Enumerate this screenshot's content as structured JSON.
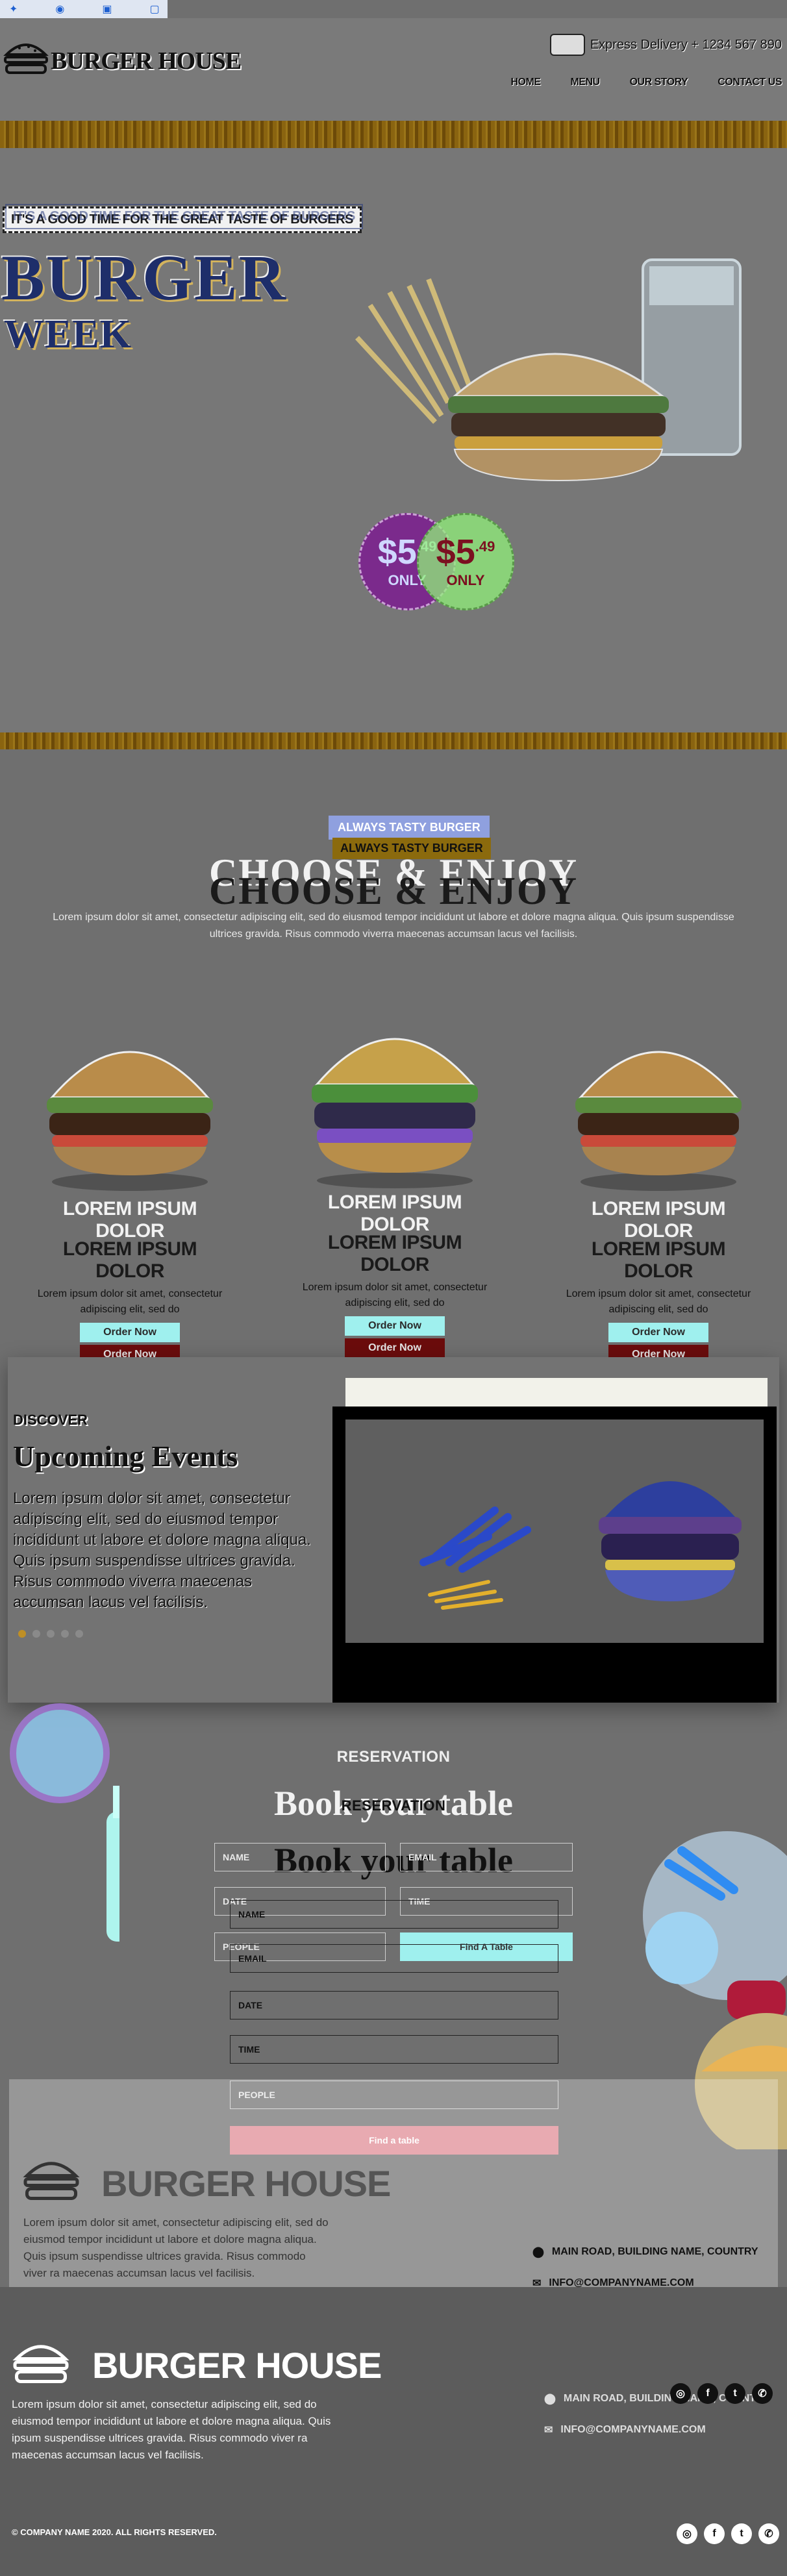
{
  "colors": {
    "gold_stripe": "#8a6410",
    "navy": "#1e2e6a",
    "purple_badge": "#7b2a8c",
    "green_badge": "#90f07a",
    "teal_button": "#9ff0ee",
    "pink_button": "#e08a94",
    "maroon": "#6b0c0c",
    "chip_blue": "#8fa0df"
  },
  "browser_icons": [
    "cursor-icon",
    "eye-icon",
    "lock-icon",
    "page-icon"
  ],
  "brand": {
    "name": "BURGER HOUSE"
  },
  "header": {
    "phone": "Express Delivery + 1234 567 890"
  },
  "nav": {
    "items": [
      "HOME",
      "MENU",
      "OUR STORY",
      "CONTACT US"
    ]
  },
  "hero": {
    "tagline": "IT'S A GOOD TIME FOR THE GREAT TASTE OF BURGERS",
    "headline": "BURGER",
    "subheadline": "WEEK",
    "price_main": "$5",
    "price_cents": ".49",
    "price_note": "ONLY"
  },
  "about": {
    "chip": "ALWAYS TASTY BURGER",
    "heading": "CHOOSE & ENJOY",
    "text": "Lorem ipsum dolor sit amet, consectetur adipiscing elit, sed do eiusmod tempor incididunt ut labore et dolore magna aliqua. Quis ipsum suspendisse ultrices gravida. Risus commodo viverra maecenas accumsan lacus vel facilisis."
  },
  "cards": [
    {
      "title": "LOREM IPSUM DOLOR",
      "text": "Lorem ipsum dolor sit amet, consectetur adipiscing elit, sed do",
      "button": "Order Now"
    },
    {
      "title": "LOREM IPSUM DOLOR",
      "text": "Lorem ipsum dolor sit amet, consectetur adipiscing elit, sed do",
      "button": "Order Now"
    },
    {
      "title": "LOREM IPSUM DOLOR",
      "text": "Lorem ipsum dolor sit amet, consectetur adipiscing elit, sed do",
      "button": "Order Now"
    }
  ],
  "events": {
    "eyebrow": "DISCOVER",
    "heading": "Upcoming Events",
    "text": "Lorem ipsum dolor sit amet, consectetur adipiscing elit, sed do eiusmod tempor incididunt ut labore et dolore magna aliqua. Quis ipsum suspendisse ultrices gravida. Risus commodo viverra maecenas accumsan lacus vel facilisis.",
    "active_slide": 1,
    "slide_count": 5
  },
  "reservation": {
    "label": "RESERVATION",
    "heading": "Book your table",
    "fields": {
      "name": "NAME",
      "email": "EMAIL",
      "date": "DATE",
      "time": "TIME",
      "people": "PEOPLE"
    },
    "button": "Find A Table",
    "button_alt": "Find a table"
  },
  "footer": {
    "brand": "BURGER HOUSE",
    "text": "Lorem ipsum dolor sit amet, consectetur adipiscing elit, sed do eiusmod tempor incididunt ut labore et dolore magna aliqua. Quis ipsum suspendisse ultrices gravida. Risus commodo viver ra maecenas accumsan lacus vel facilisis.",
    "address": "MAIN ROAD, BUILDING NAME, COUNTRY",
    "email": "INFO@COMPANYNAME.COM",
    "copyright": "© COMPANY NAME 2020. ALL RIGHTS RESERVED.",
    "social": [
      "instagram-icon",
      "facebook-icon",
      "twitter-icon",
      "whatsapp-icon"
    ]
  }
}
